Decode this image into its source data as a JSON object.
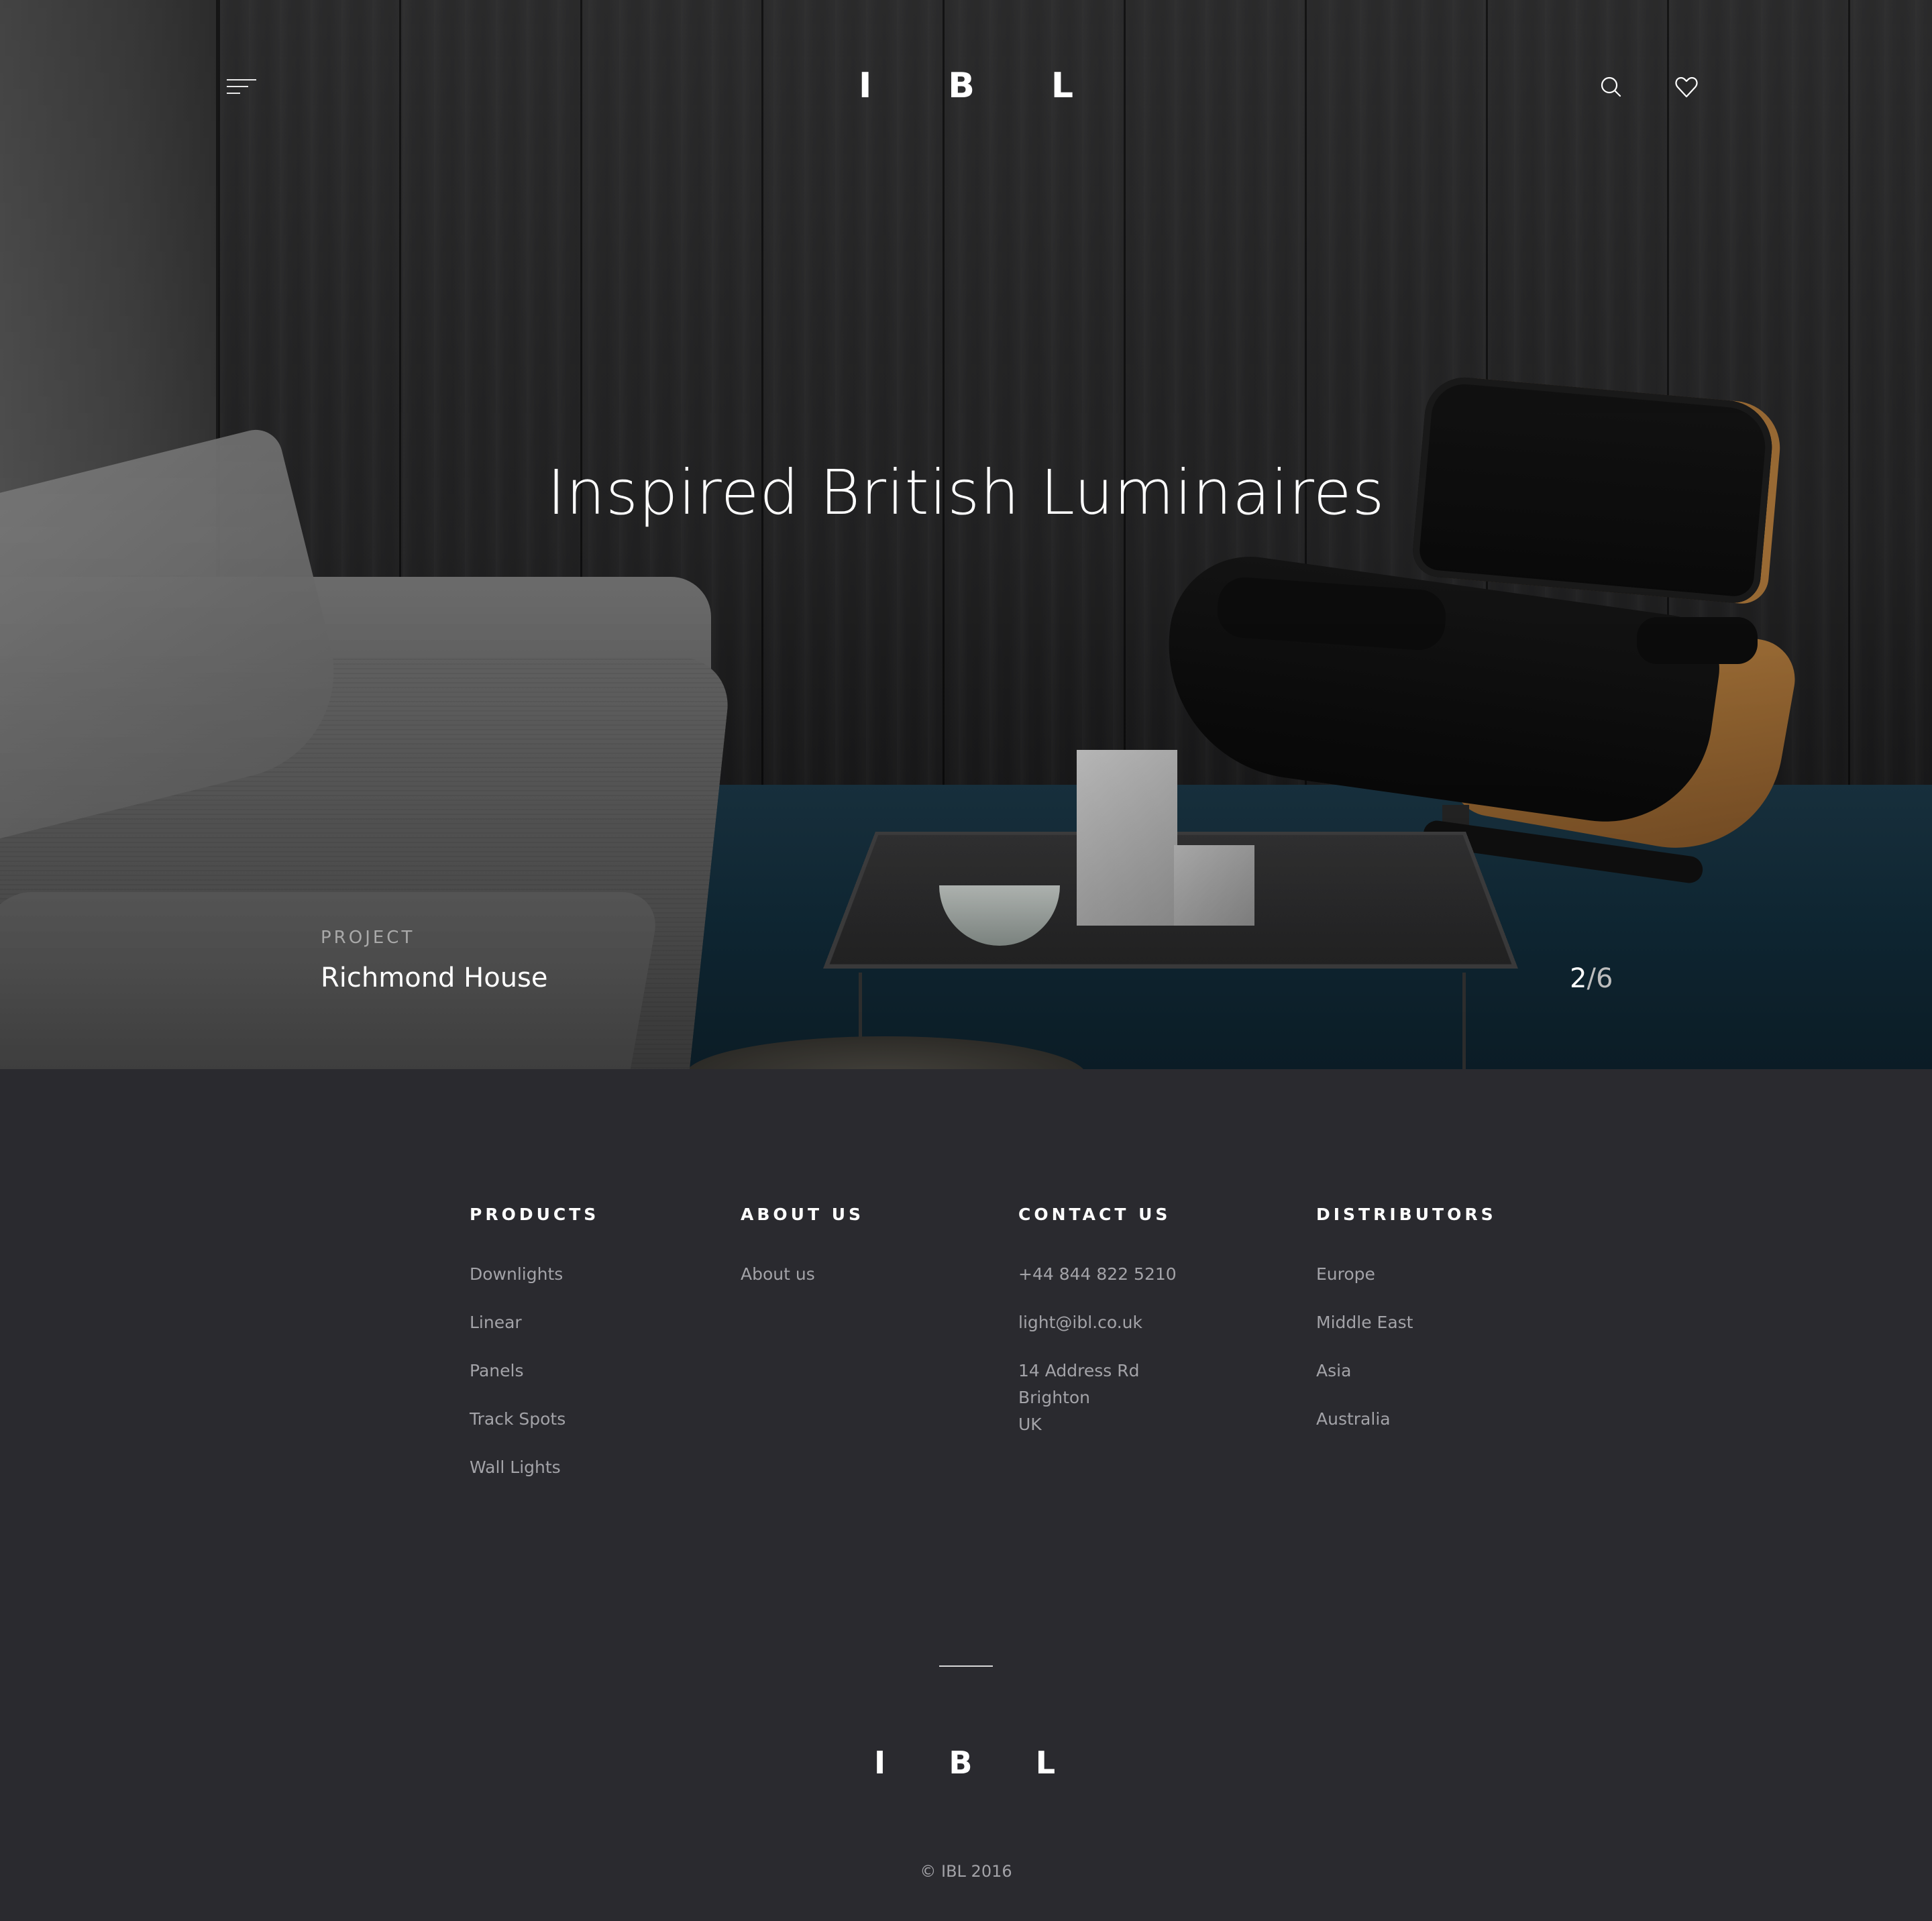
{
  "header": {
    "logo_letters": [
      "I",
      "B",
      "L"
    ],
    "icons": {
      "menu": "hamburger-menu-icon",
      "search": "search-icon",
      "favorites": "heart-icon"
    }
  },
  "hero": {
    "title": "Inspired British Luminaires",
    "project_label": "PROJECT",
    "project_name": "Richmond House",
    "slide_current": "2",
    "slide_separator": "/",
    "slide_total": "6"
  },
  "footer": {
    "columns": {
      "products": {
        "heading": "PRODUCTS",
        "items": [
          "Downlights",
          "Linear",
          "Panels",
          "Track Spots",
          "Wall Lights"
        ]
      },
      "about": {
        "heading": "ABOUT US",
        "items": [
          "About us"
        ]
      },
      "contact": {
        "heading": "CONTACT US",
        "phone": "+44 844 822 5210",
        "email": "light@ibl.co.uk",
        "address": [
          "14 Address Rd",
          "Brighton",
          "UK"
        ]
      },
      "distributors": {
        "heading": "DISTRIBUTORS",
        "items": [
          "Europe",
          "Middle East",
          "Asia",
          "Australia"
        ]
      }
    },
    "logo_letters": [
      "I",
      "B",
      "L"
    ],
    "copyright": "© IBL 2016"
  },
  "colors": {
    "footer_bg": "#2a2a2f",
    "text_white": "#ffffff",
    "text_muted": "#a3a3a8",
    "carpet_blue": "#13303f",
    "chair_wood": "#b07a3c"
  }
}
